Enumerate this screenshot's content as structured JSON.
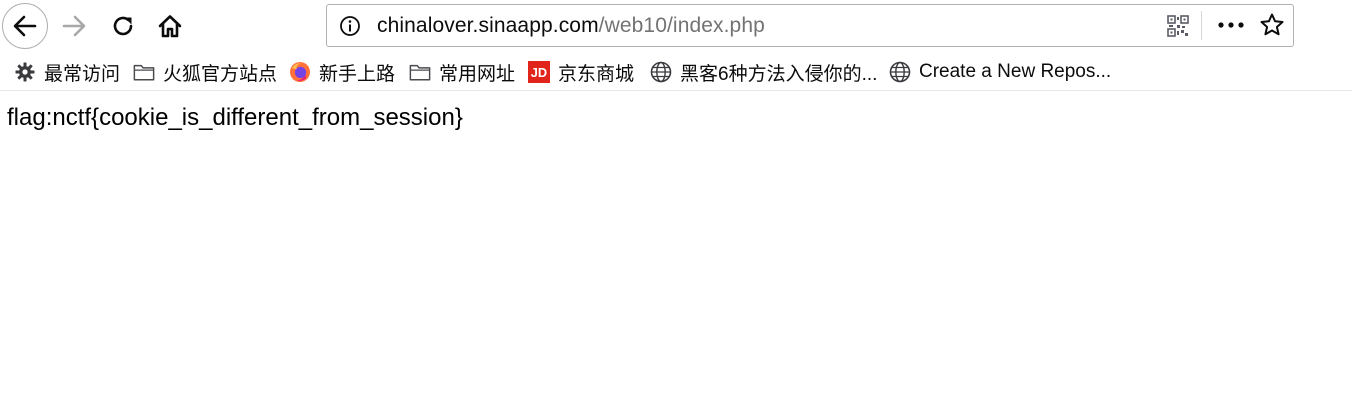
{
  "toolbar": {
    "back_icon": "arrow-left-icon",
    "forward_icon": "arrow-right-icon",
    "reload_icon": "reload-icon",
    "home_icon": "home-icon"
  },
  "urlbar": {
    "host": "chinalover.sinaapp.com",
    "path": "/web10/index.php",
    "info_icon": "info-icon",
    "qr_icon": "qr-code-icon",
    "more_icon": "more-dots-icon",
    "star_icon": "star-icon"
  },
  "bookmarks": [
    {
      "label": "最常访问",
      "icon": "gear-icon"
    },
    {
      "label": "火狐官方站点",
      "icon": "folder-icon"
    },
    {
      "label": "新手上路",
      "icon": "firefox-icon"
    },
    {
      "label": "常用网址",
      "icon": "folder-icon"
    },
    {
      "label": "京东商城",
      "icon": "jd-icon"
    },
    {
      "label": "黑客6种方法入侵你的...",
      "icon": "globe-icon"
    },
    {
      "label": "Create a New Repos...",
      "icon": "globe-icon"
    }
  ],
  "colors": {
    "jd_red": "#e1251b",
    "firefox_orange": "#ff7139",
    "firefox_purple": "#7542e5",
    "url_path_gray": "#737373"
  },
  "page": {
    "content": "flag:nctf{cookie_is_different_from_session}"
  }
}
